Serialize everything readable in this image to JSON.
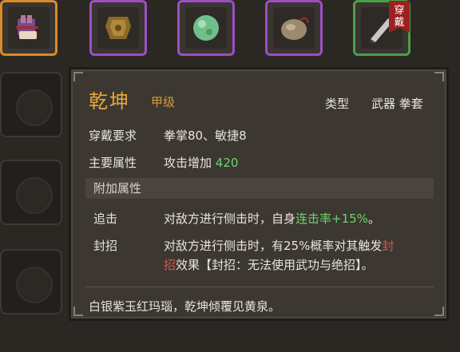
{
  "slots": [
    {
      "name": "gauntlet-icon",
      "rarity": "orange"
    },
    {
      "name": "armor-icon",
      "rarity": "purple"
    },
    {
      "name": "jade-orb-icon",
      "rarity": "purple"
    },
    {
      "name": "stone-pouch-icon",
      "rarity": "purple"
    },
    {
      "name": "blade-icon",
      "rarity": "green",
      "tag_line1": "穿",
      "tag_line2": "戴"
    }
  ],
  "item": {
    "name": "乾坤",
    "grade": "甲级",
    "type_label": "类型",
    "type_value": "武器 拳套",
    "req_label": "穿戴要求",
    "req_value": "拳掌80、敏捷8",
    "attr_label": "主要属性",
    "attr_text": "攻击增加",
    "attr_value": "420",
    "extra_header": "附加属性",
    "skills": [
      {
        "name": "追击",
        "desc_pre": "对敌方进行侧击时，自身",
        "desc_hl": "连击率+15%",
        "desc_post": "。"
      },
      {
        "name": "封招",
        "line1_pre": "对敌方进行侧击时，有25%概率对其触发",
        "line1_hl": "封",
        "line2_hl": "招",
        "line2_post": "效果【封招：无法使用武功与绝招】。"
      }
    ],
    "flavor": "白银紫玉红玛瑙，乾坤倾覆见黄泉。"
  },
  "colors": {
    "orange": "#d98a2b",
    "purple": "#9c4fc4",
    "green": "#4aa04a",
    "name": "#e8a83a",
    "highlight_green": "#6cd36c",
    "highlight_red": "#e0504a"
  }
}
